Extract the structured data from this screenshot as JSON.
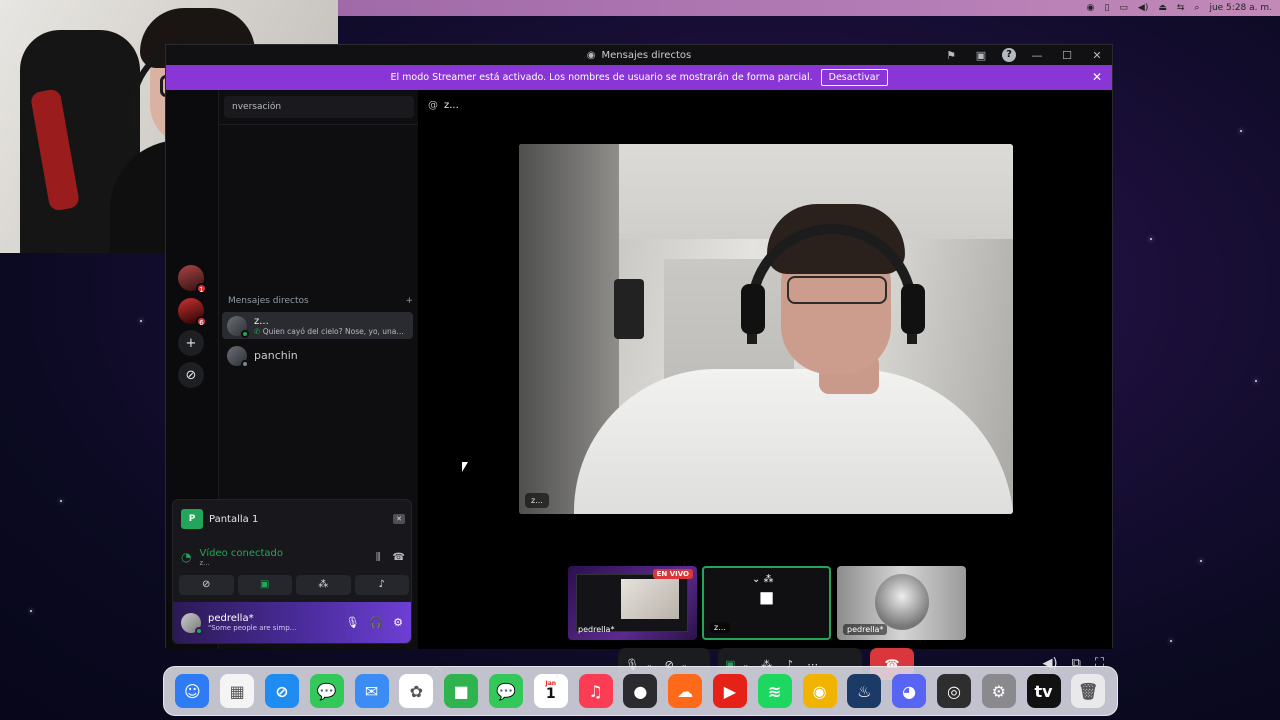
{
  "menubar": {
    "clock": "jue 5:28 a. m.",
    "icons": [
      "user-circle-icon",
      "phone-icon",
      "display-icon",
      "volume-icon",
      "eject-icon",
      "network-icon",
      "search-icon"
    ]
  },
  "window": {
    "title": "Mensajes directos",
    "streamer_banner": {
      "text": "El modo Streamer está activado. Los nombres de usuario se mostrarán de forma parcial.",
      "button": "Desactivar"
    }
  },
  "sidebar": {
    "conversation_search": "nversación",
    "dm_header": "Mensajes directos",
    "dm_add": "+",
    "dms": [
      {
        "name": "z...",
        "subtitle": "Quien cayó del cielo? Nose, yo, una e..."
      },
      {
        "name": "panchin",
        "subtitle": ""
      }
    ],
    "rail_badges": [
      "1",
      "6"
    ]
  },
  "voice": {
    "screen_label": "Pantalla 1",
    "screen_letter": "P",
    "status": "Vídeo conectado",
    "sub": "z..."
  },
  "user": {
    "name": "pedrella*",
    "status": "\"Some people are simp..."
  },
  "call": {
    "header_name": "z...",
    "main_label": "z...",
    "thumbs": [
      {
        "label": "pedrella*",
        "live": "EN VIVO"
      },
      {
        "label": "z..."
      },
      {
        "label": "pedrella*"
      }
    ]
  },
  "dock": {
    "calendar_month": "Jan",
    "calendar_day": "1",
    "apps": [
      {
        "name": "finder-icon",
        "color": "#2f7bf5",
        "glyph": "☺"
      },
      {
        "name": "launchpad-icon",
        "color": "#f4f4f4",
        "glyph": "▦"
      },
      {
        "name": "safari-icon",
        "color": "#1e8cf0",
        "glyph": "⊘"
      },
      {
        "name": "messages-icon",
        "color": "#34c759",
        "glyph": "💬"
      },
      {
        "name": "mail-icon",
        "color": "#3b8cf5",
        "glyph": "✉"
      },
      {
        "name": "photos-icon",
        "color": "#ffffff",
        "glyph": "✿"
      },
      {
        "name": "facetime-icon",
        "color": "#2fb34f",
        "glyph": "■"
      },
      {
        "name": "messages-alt-icon",
        "color": "#34c759",
        "glyph": "💬"
      },
      {
        "name": "calendar-icon",
        "color": "#ffffff",
        "glyph": ""
      },
      {
        "name": "music-icon",
        "color": "#fa3c55",
        "glyph": "♫"
      },
      {
        "name": "apple-tv-app-icon",
        "color": "#2b2b2f",
        "glyph": "●"
      },
      {
        "name": "soundcloud-icon",
        "color": "#ff6a1a",
        "glyph": "☁"
      },
      {
        "name": "youtube-icon",
        "color": "#e62117",
        "glyph": "▶"
      },
      {
        "name": "spotify-icon",
        "color": "#1ed760",
        "glyph": "≋"
      },
      {
        "name": "chrome-icon",
        "color": "#f0b400",
        "glyph": "◉"
      },
      {
        "name": "steam-icon",
        "color": "#1b3b66",
        "glyph": "♨"
      },
      {
        "name": "discord-icon",
        "color": "#5865f2",
        "glyph": "◕"
      },
      {
        "name": "obs-icon",
        "color": "#2e2e2e",
        "glyph": "◎"
      },
      {
        "name": "settings-icon",
        "color": "#8a8a8e",
        "glyph": "⚙"
      },
      {
        "name": "tv-icon",
        "color": "#111111",
        "glyph": "tv"
      },
      {
        "name": "trash-icon",
        "color": "#e9e9ec",
        "glyph": "🗑"
      }
    ]
  },
  "colors": {
    "streamer_banner": "#8a35d6",
    "accent_green": "#23a55a",
    "hangup_red": "#da373c"
  }
}
